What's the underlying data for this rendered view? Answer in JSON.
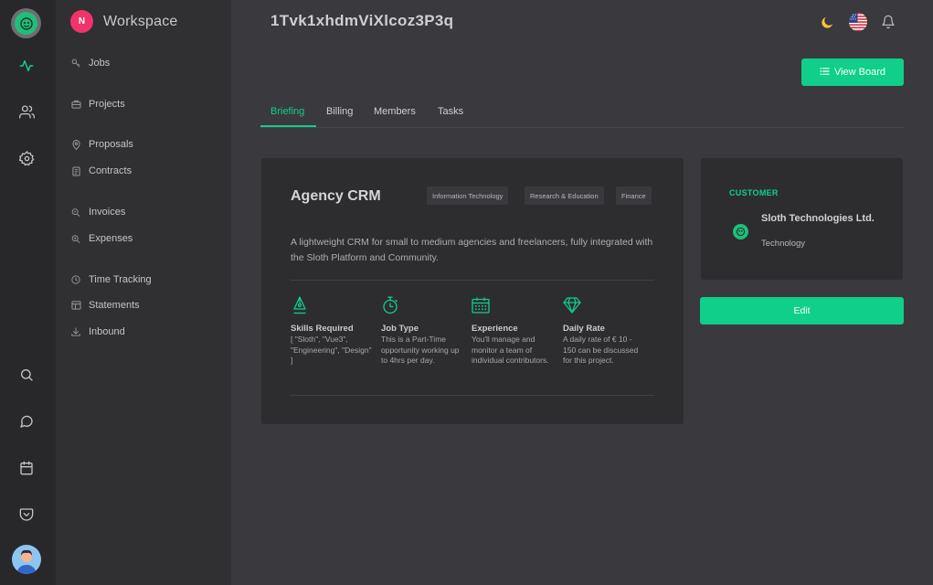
{
  "sidebar": {
    "workspace_initial": "N",
    "workspace_name": "Workspace",
    "items": [
      {
        "label": "Jobs"
      },
      {
        "label": "Projects"
      },
      {
        "label": "Proposals"
      },
      {
        "label": "Contracts"
      },
      {
        "label": "Invoices"
      },
      {
        "label": "Expenses"
      },
      {
        "label": "Time Tracking"
      },
      {
        "label": "Statements"
      },
      {
        "label": "Inbound"
      }
    ]
  },
  "rail": {
    "icons": [
      "sloth-logo-icon",
      "activity-icon",
      "users-icon",
      "settings-icon",
      "search-icon",
      "chat-icon",
      "calendar-icon",
      "pocket-icon",
      "user-avatar"
    ]
  },
  "header": {
    "title": "1Tvk1xhdmViXlcoz3P3q",
    "icons": [
      "moon-icon",
      "us-flag-icon",
      "bell-icon"
    ]
  },
  "actions": {
    "view_board": "View Board",
    "edit": "Edit"
  },
  "tabs": [
    {
      "label": "Briefing",
      "active": true
    },
    {
      "label": "Billing",
      "active": false
    },
    {
      "label": "Members",
      "active": false
    },
    {
      "label": "Tasks",
      "active": false
    }
  ],
  "project": {
    "title": "Agency CRM",
    "tags": [
      "Information Technology",
      "Research & Education",
      "Finance"
    ],
    "description": "A lightweight CRM for small to medium agencies and freelancers, fully integrated with the Sloth Platform and Community.",
    "features": [
      {
        "label": "Skills Required",
        "text": "[ \"Sloth\", \"Vue3\", \"Engineering\", \"Design\" ]",
        "icon": "pen-nib-icon"
      },
      {
        "label": "Job Type",
        "text": "This is a Part-Time opportunity working up to 4hrs per day.",
        "icon": "stopwatch-icon"
      },
      {
        "label": "Experience",
        "text": "You'll manage and monitor a team of individual contributors.",
        "icon": "calendar-grid-icon"
      },
      {
        "label": "Daily Rate",
        "text": "A daily rate of € 10 - 150 can be discussed for this project.",
        "icon": "diamond-icon"
      }
    ]
  },
  "customer": {
    "label": "CUSTOMER",
    "name": "Sloth Technologies Ltd.",
    "industry": "Technology"
  },
  "colors": {
    "accent": "#0fcf8a",
    "workspace_badge": "#f0346b",
    "background": "#3a393d",
    "card": "#2d2d30"
  }
}
